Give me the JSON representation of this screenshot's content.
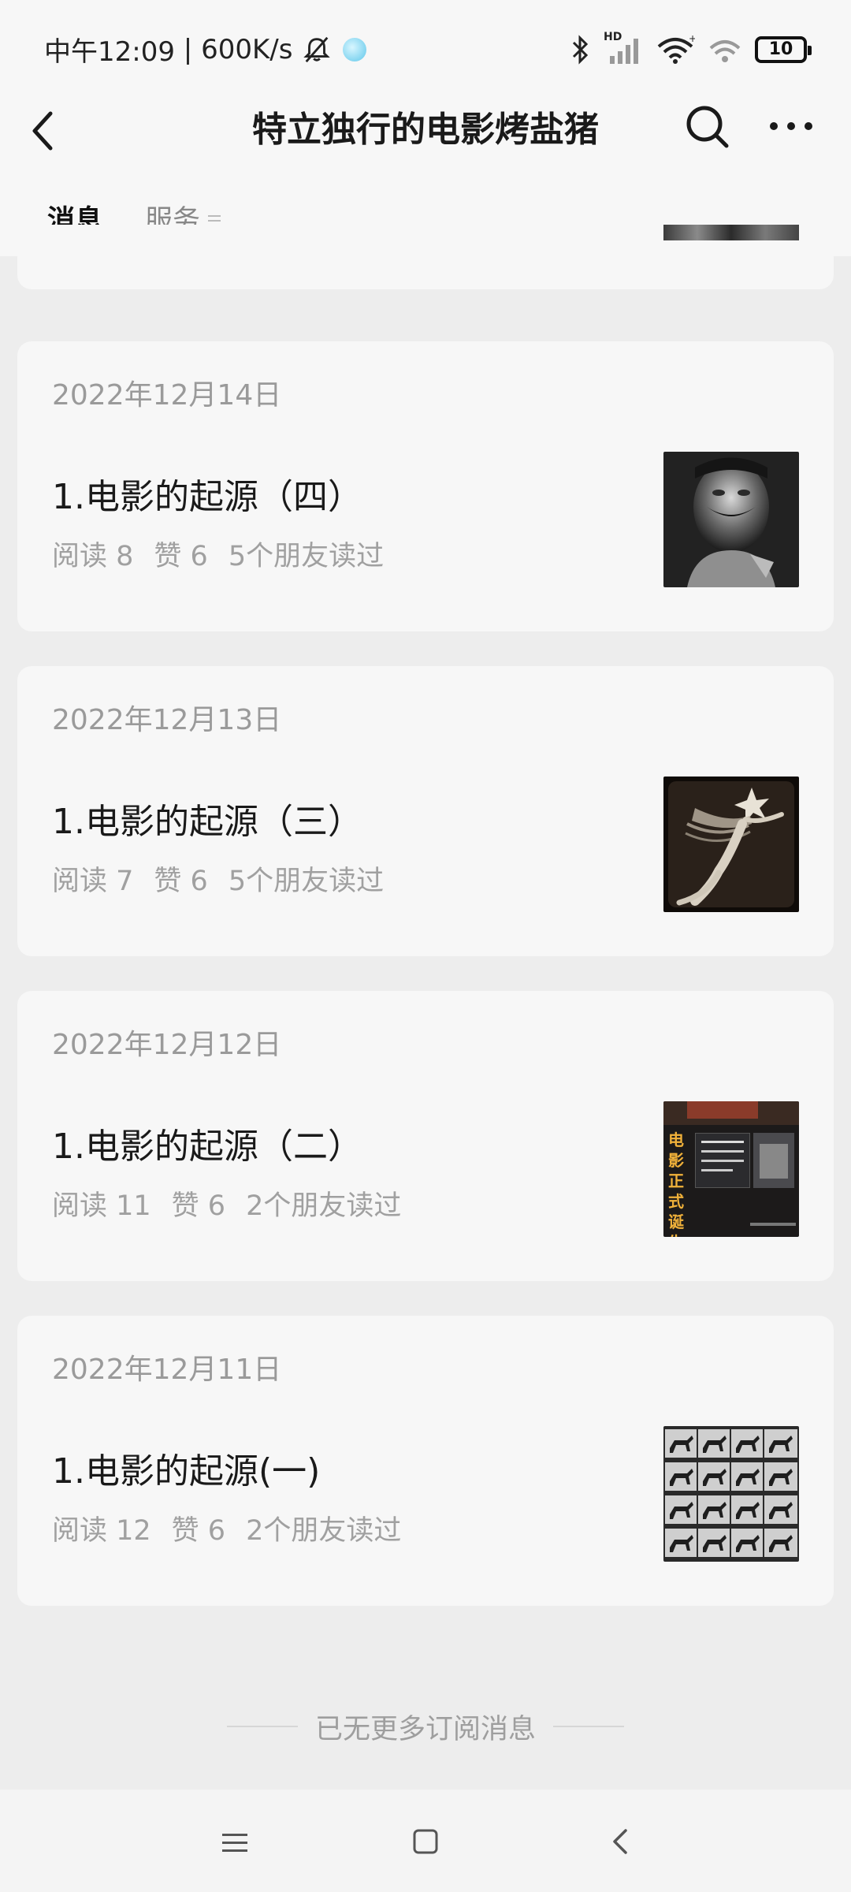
{
  "status_bar": {
    "time": "中午12:09",
    "speed": "600K/s",
    "battery": "10",
    "signal_label": "HD"
  },
  "nav": {
    "title": "特立独行的电影烤盐猪"
  },
  "tabs": [
    {
      "label": "消息",
      "active": true
    },
    {
      "label": "服务",
      "active": false
    }
  ],
  "articles": [
    {
      "date": "2022年12月14日",
      "title": "1.电影的起源（四）",
      "reads": "阅读 8",
      "likes": "赞 6",
      "friends": "5个朋友读过"
    },
    {
      "date": "2022年12月13日",
      "title": "1.电影的起源（三）",
      "reads": "阅读 7",
      "likes": "赞 6",
      "friends": "5个朋友读过"
    },
    {
      "date": "2022年12月12日",
      "title": "1.电影的起源（二）",
      "reads": "阅读 11",
      "likes": "赞 6",
      "friends": "2个朋友读过",
      "thumb_text": "电影正式诞生"
    },
    {
      "date": "2022年12月11日",
      "title": "1.电影的起源(一)",
      "reads": "阅读 12",
      "likes": "赞 6",
      "friends": "2个朋友读过"
    }
  ],
  "footer": {
    "end_text": "已无更多订阅消息"
  },
  "colors": {
    "background": "#ededed",
    "card": "#f7f7f7",
    "muted_text": "#9a9a9a"
  }
}
